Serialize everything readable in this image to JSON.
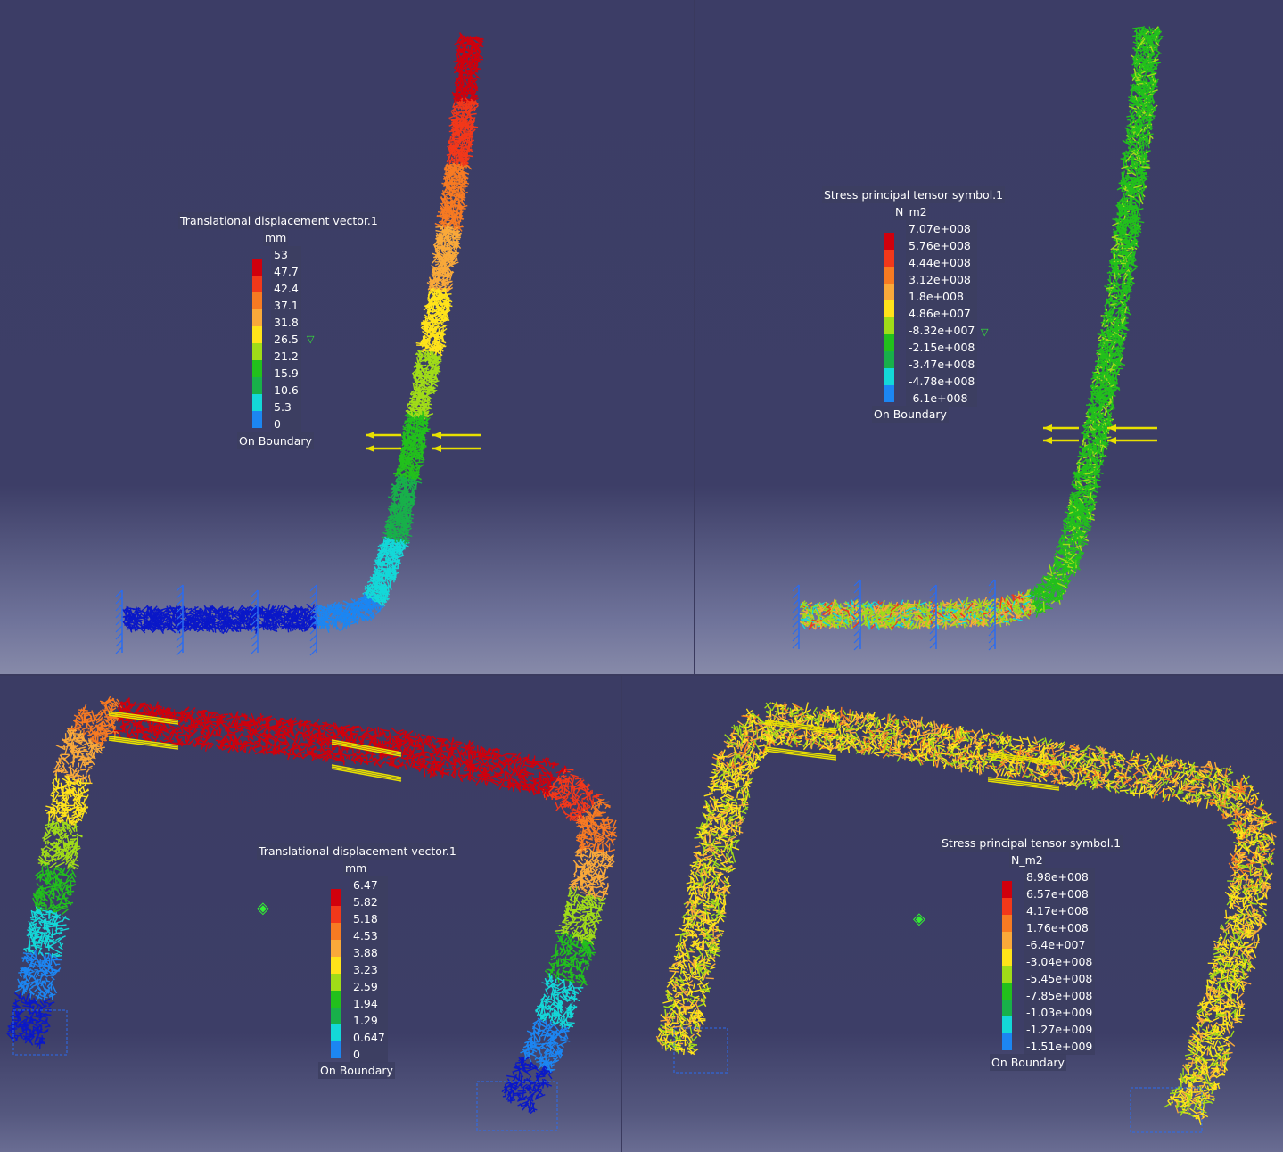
{
  "panels": [
    {
      "legend": {
        "title": "Translational displacement vector.1",
        "unit": "mm",
        "values": [
          "53",
          "47.7",
          "42.4",
          "37.1",
          "31.8",
          "26.5",
          "21.2",
          "15.9",
          "10.6",
          "5.3",
          "0"
        ],
        "footer": "On Boundary"
      }
    },
    {
      "legend": {
        "title": "Stress principal tensor symbol.1",
        "unit": "N_m2",
        "values": [
          "7.07e+008",
          "5.76e+008",
          "4.44e+008",
          "3.12e+008",
          "1.8e+008",
          "4.86e+007",
          "-8.32e+007",
          "-2.15e+008",
          "-3.47e+008",
          "-4.78e+008",
          "-6.1e+008"
        ],
        "footer": "On Boundary"
      }
    },
    {
      "legend": {
        "title": "Translational displacement vector.1",
        "unit": "mm",
        "values": [
          "6.47",
          "5.82",
          "5.18",
          "4.53",
          "3.88",
          "3.23",
          "2.59",
          "1.94",
          "1.29",
          "0.647",
          "0"
        ],
        "footer": "On Boundary"
      }
    },
    {
      "legend": {
        "title": "Stress principal tensor symbol.1",
        "unit": "N_m2",
        "values": [
          "8.98e+008",
          "6.57e+008",
          "4.17e+008",
          "1.76e+008",
          "-6.4e+007",
          "-3.04e+008",
          "-5.45e+008",
          "-7.85e+008",
          "-1.03e+009",
          "-1.27e+009",
          "-1.51e+009"
        ],
        "footer": "On Boundary"
      }
    }
  ],
  "colors": {
    "scale": [
      "#d0000c",
      "#f2381a",
      "#f77a22",
      "#f9a93a",
      "#ffe31a",
      "#a0dc18",
      "#22c01c",
      "#18b04a",
      "#14d8d8",
      "#1c86f2",
      "#0a18c8"
    ],
    "load_arrow": "#e8e000",
    "clamp": "#2a6cf0"
  }
}
